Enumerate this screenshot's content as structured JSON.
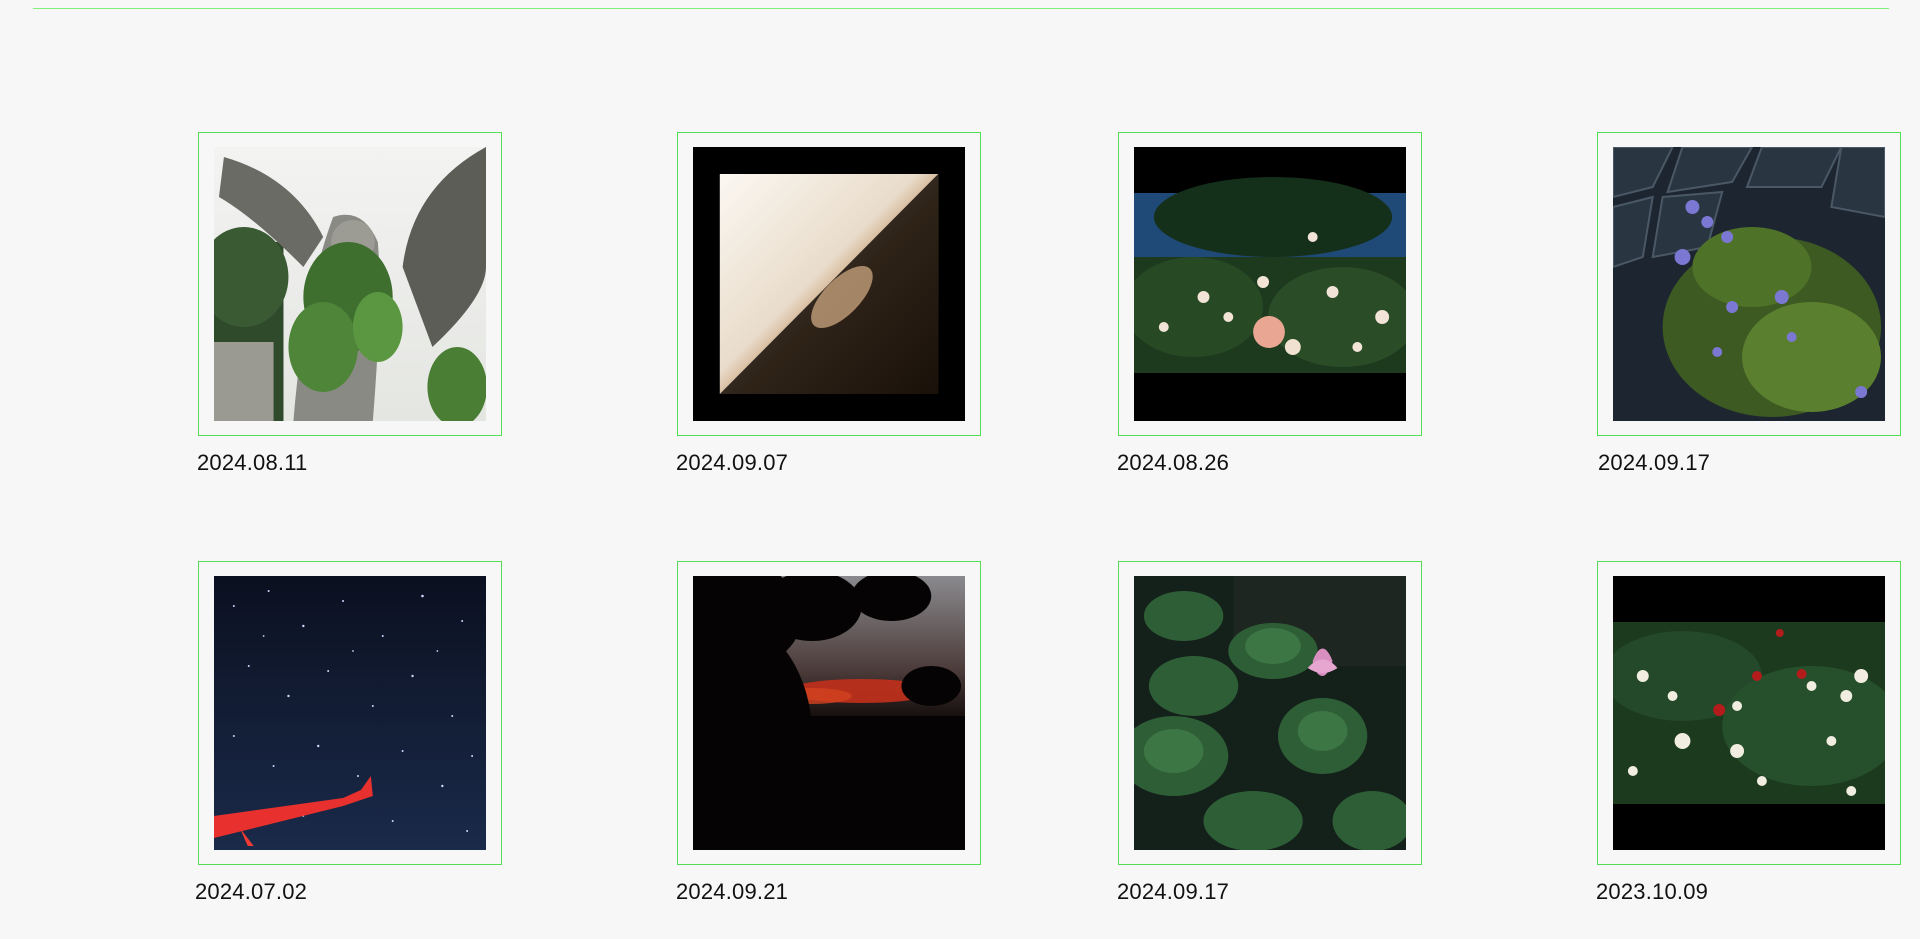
{
  "gallery": {
    "items": [
      {
        "date": "2024.08.11",
        "photo": "angel-statue-with-ivy"
      },
      {
        "date": "2024.09.07",
        "photo": "light-diagonal-abstract"
      },
      {
        "date": "2024.08.26",
        "photo": "rose-bushes-blue-sky"
      },
      {
        "date": "2024.09.17",
        "photo": "purple-flowers-glass-building"
      },
      {
        "date": "2024.07.02",
        "photo": "starry-sky-airplane-wing"
      },
      {
        "date": "2024.09.21",
        "photo": "sunset-tree-silhouette"
      },
      {
        "date": "2024.09.17",
        "photo": "lotus-pond"
      },
      {
        "date": "2023.10.09",
        "photo": "white-and-red-roses"
      }
    ]
  },
  "colors": {
    "background": "#f7f7f7",
    "card_border": "#55dd55",
    "top_rule": "#7df07d"
  }
}
